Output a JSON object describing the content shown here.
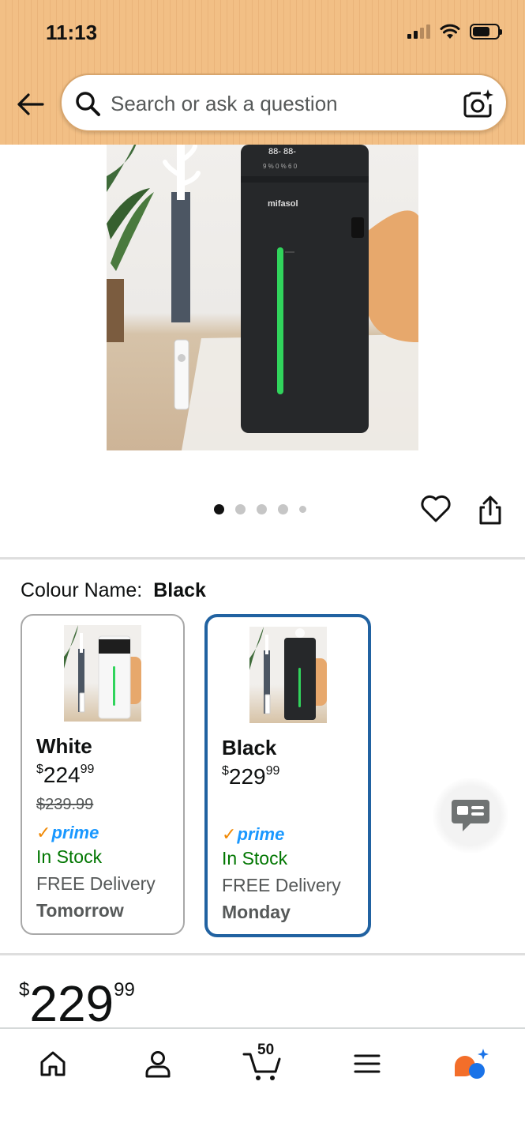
{
  "status_bar": {
    "time": "11:13"
  },
  "search": {
    "placeholder": "Search or ask a question"
  },
  "product_image": {
    "brand_text": "mifasol"
  },
  "carousel": {
    "dot_count": 5,
    "active_index": 0
  },
  "colour": {
    "label": "Colour Name:",
    "selected_value": "Black"
  },
  "variants": [
    {
      "name": "White",
      "price_currency": "$",
      "price_whole": "224",
      "price_fraction": "99",
      "old_price": "$239.99",
      "prime_label": "prime",
      "stock": "In Stock",
      "delivery": "FREE Delivery",
      "delivery_day": "Tomorrow",
      "selected": false
    },
    {
      "name": "Black",
      "price_currency": "$",
      "price_whole": "229",
      "price_fraction": "99",
      "prime_label": "prime",
      "stock": "In Stock",
      "delivery": "FREE Delivery",
      "delivery_day": "Monday",
      "selected": true
    }
  ],
  "price": {
    "currency": "$",
    "whole": "229",
    "fraction": "99"
  },
  "bottom_nav": {
    "cart_count": "50"
  },
  "colors": {
    "header_bg": "#f2bf85",
    "selected_border": "#2162a1",
    "stock_green": "#007600",
    "prime_blue": "#1a98ff",
    "prime_check": "#f08804"
  }
}
